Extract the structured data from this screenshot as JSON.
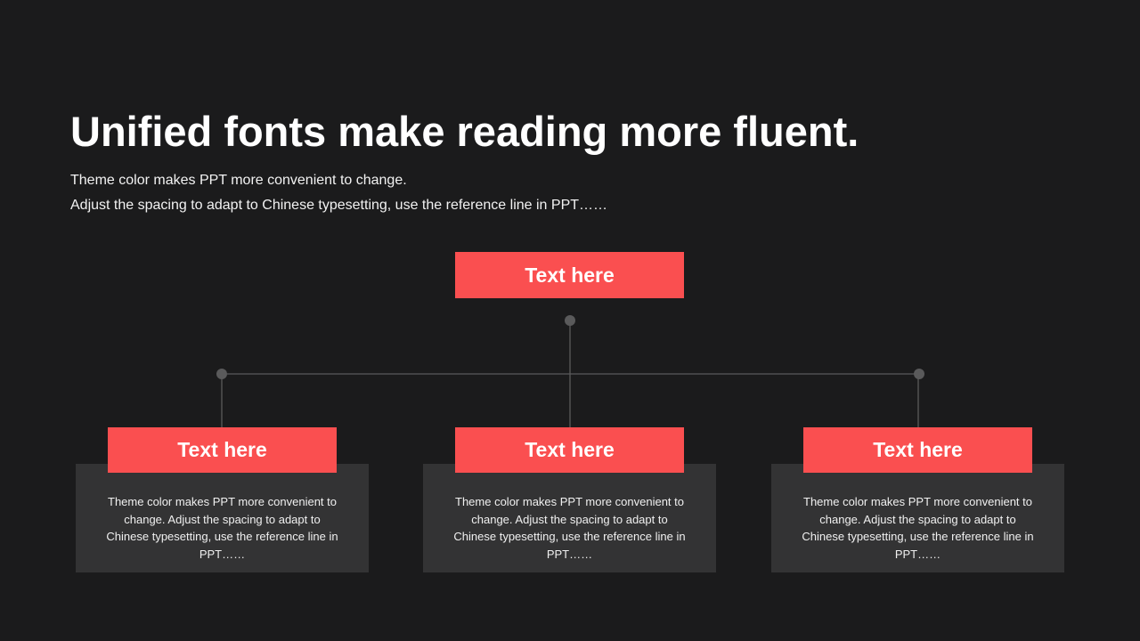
{
  "header": {
    "title": "Unified fonts make reading more fluent.",
    "subtitle_line1": "Theme color makes PPT more convenient to change.",
    "subtitle_line2": "Adjust the spacing to adapt to Chinese typesetting, use the reference line in PPT……"
  },
  "diagram": {
    "root": {
      "label": "Text here"
    },
    "children": [
      {
        "label": "Text here",
        "description": "Theme color makes PPT more convenient to change. Adjust the spacing to adapt to Chinese typesetting, use the reference line in PPT……"
      },
      {
        "label": "Text here",
        "description": "Theme color makes PPT more convenient to change. Adjust the spacing to adapt to Chinese typesetting, use the reference line in PPT……"
      },
      {
        "label": "Text here",
        "description": "Theme color makes PPT more convenient to change. Adjust the spacing to adapt to Chinese typesetting, use the reference line in PPT……"
      }
    ]
  },
  "colors": {
    "background": "#1b1b1c",
    "accent": "#fa4f50",
    "card": "#333334",
    "connector": "#5a5a5b"
  }
}
